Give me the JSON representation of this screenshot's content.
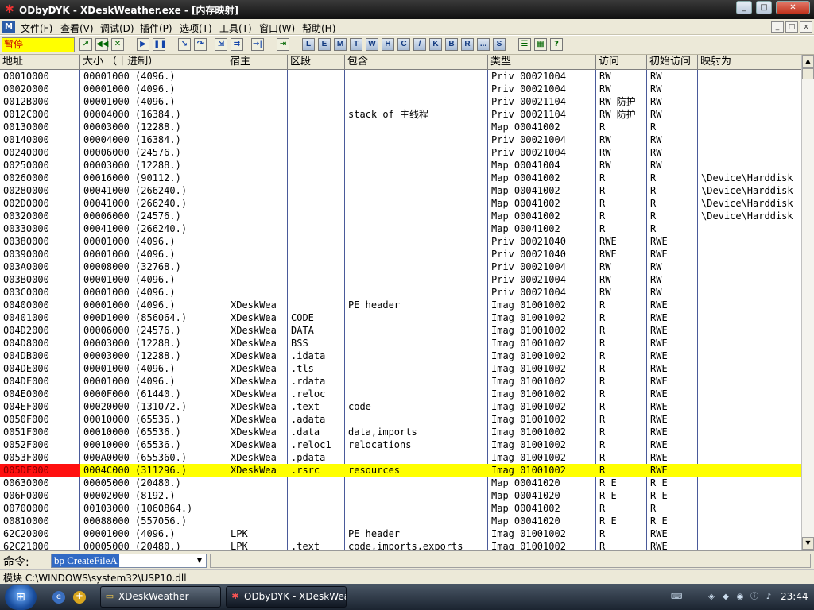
{
  "window": {
    "title": "ODbyDYK - XDeskWeather.exe - [内存映射]",
    "minimize": "_",
    "maximize": "□",
    "close": "✕"
  },
  "menu": {
    "items": [
      "文件(F)",
      "查看(V)",
      "调试(D)",
      "插件(P)",
      "选项(T)",
      "工具(T)",
      "窗口(W)",
      "帮助(H)"
    ],
    "mdi_buttons": [
      "_",
      "□",
      "x"
    ]
  },
  "toolbar": {
    "status": "暂停",
    "letter_buttons": [
      "L",
      "E",
      "M",
      "T",
      "W",
      "H",
      "C",
      "/",
      "K",
      "B",
      "R",
      "...",
      "S"
    ]
  },
  "table": {
    "columns": [
      "地址",
      "大小 （十进制）",
      "宿主",
      "区段",
      "包含",
      "类型",
      "访问",
      "初始访问",
      "映射为"
    ],
    "rows": [
      [
        "00010000",
        "00001000 (4096.)",
        "",
        "",
        "",
        "Priv 00021004",
        "RW",
        "RW",
        ""
      ],
      [
        "00020000",
        "00001000 (4096.)",
        "",
        "",
        "",
        "Priv 00021004",
        "RW",
        "RW",
        ""
      ],
      [
        "0012B000",
        "00001000 (4096.)",
        "",
        "",
        "",
        "Priv 00021104",
        "RW  防护",
        "RW",
        ""
      ],
      [
        "0012C000",
        "00004000 (16384.)",
        "",
        "",
        "stack of 主线程",
        "Priv 00021104",
        "RW  防护",
        "RW",
        ""
      ],
      [
        "00130000",
        "00003000 (12288.)",
        "",
        "",
        "",
        "Map  00041002",
        "R",
        "R",
        ""
      ],
      [
        "00140000",
        "00004000 (16384.)",
        "",
        "",
        "",
        "Priv 00021004",
        "RW",
        "RW",
        ""
      ],
      [
        "00240000",
        "00006000 (24576.)",
        "",
        "",
        "",
        "Priv 00021004",
        "RW",
        "RW",
        ""
      ],
      [
        "00250000",
        "00003000 (12288.)",
        "",
        "",
        "",
        "Map  00041004",
        "RW",
        "RW",
        ""
      ],
      [
        "00260000",
        "00016000 (90112.)",
        "",
        "",
        "",
        "Map  00041002",
        "R",
        "R",
        "\\Device\\Harddisk"
      ],
      [
        "00280000",
        "00041000 (266240.)",
        "",
        "",
        "",
        "Map  00041002",
        "R",
        "R",
        "\\Device\\Harddisk"
      ],
      [
        "002D0000",
        "00041000 (266240.)",
        "",
        "",
        "",
        "Map  00041002",
        "R",
        "R",
        "\\Device\\Harddisk"
      ],
      [
        "00320000",
        "00006000 (24576.)",
        "",
        "",
        "",
        "Map  00041002",
        "R",
        "R",
        "\\Device\\Harddisk"
      ],
      [
        "00330000",
        "00041000 (266240.)",
        "",
        "",
        "",
        "Map  00041002",
        "R",
        "R",
        ""
      ],
      [
        "00380000",
        "00001000 (4096.)",
        "",
        "",
        "",
        "Priv 00021040",
        "RWE",
        "RWE",
        ""
      ],
      [
        "00390000",
        "00001000 (4096.)",
        "",
        "",
        "",
        "Priv 00021040",
        "RWE",
        "RWE",
        ""
      ],
      [
        "003A0000",
        "00008000 (32768.)",
        "",
        "",
        "",
        "Priv 00021004",
        "RW",
        "RW",
        ""
      ],
      [
        "003B0000",
        "00001000 (4096.)",
        "",
        "",
        "",
        "Priv 00021004",
        "RW",
        "RW",
        ""
      ],
      [
        "003C0000",
        "00001000 (4096.)",
        "",
        "",
        "",
        "Priv 00021004",
        "RW",
        "RW",
        ""
      ],
      [
        "00400000",
        "00001000 (4096.)",
        "XDeskWea",
        "",
        "PE header",
        "Imag 01001002",
        "R",
        "RWE",
        ""
      ],
      [
        "00401000",
        "000D1000 (856064.)",
        "XDeskWea",
        "CODE",
        "",
        "Imag 01001002",
        "R",
        "RWE",
        ""
      ],
      [
        "004D2000",
        "00006000 (24576.)",
        "XDeskWea",
        "DATA",
        "",
        "Imag 01001002",
        "R",
        "RWE",
        ""
      ],
      [
        "004D8000",
        "00003000 (12288.)",
        "XDeskWea",
        "BSS",
        "",
        "Imag 01001002",
        "R",
        "RWE",
        ""
      ],
      [
        "004DB000",
        "00003000 (12288.)",
        "XDeskWea",
        ".idata",
        "",
        "Imag 01001002",
        "R",
        "RWE",
        ""
      ],
      [
        "004DE000",
        "00001000 (4096.)",
        "XDeskWea",
        ".tls",
        "",
        "Imag 01001002",
        "R",
        "RWE",
        ""
      ],
      [
        "004DF000",
        "00001000 (4096.)",
        "XDeskWea",
        ".rdata",
        "",
        "Imag 01001002",
        "R",
        "RWE",
        ""
      ],
      [
        "004E0000",
        "0000F000 (61440.)",
        "XDeskWea",
        ".reloc",
        "",
        "Imag 01001002",
        "R",
        "RWE",
        ""
      ],
      [
        "004EF000",
        "00020000 (131072.)",
        "XDeskWea",
        ".text",
        "code",
        "Imag 01001002",
        "R",
        "RWE",
        ""
      ],
      [
        "0050F000",
        "00010000 (65536.)",
        "XDeskWea",
        ".adata",
        "",
        "Imag 01001002",
        "R",
        "RWE",
        ""
      ],
      [
        "0051F000",
        "00010000 (65536.)",
        "XDeskWea",
        ".data",
        "data,imports",
        "Imag 01001002",
        "R",
        "RWE",
        ""
      ],
      [
        "0052F000",
        "00010000 (65536.)",
        "XDeskWea",
        ".reloc1",
        "relocations",
        "Imag 01001002",
        "R",
        "RWE",
        ""
      ],
      [
        "0053F000",
        "000A0000 (655360.)",
        "XDeskWea",
        ".pdata",
        "",
        "Imag 01001002",
        "R",
        "RWE",
        ""
      ],
      [
        "005DF000",
        "0004C000 (311296.)",
        "XDeskWea",
        ".rsrc",
        "resources",
        "Imag 01001002",
        "R",
        "RWE",
        ""
      ],
      [
        "00630000",
        "00005000 (20480.)",
        "",
        "",
        "",
        "Map  00041020",
        "R E",
        "R E",
        ""
      ],
      [
        "006F0000",
        "00002000 (8192.)",
        "",
        "",
        "",
        "Map  00041020",
        "R E",
        "R E",
        ""
      ],
      [
        "00700000",
        "00103000 (1060864.)",
        "",
        "",
        "",
        "Map  00041002",
        "R",
        "R",
        ""
      ],
      [
        "00810000",
        "00088000 (557056.)",
        "",
        "",
        "",
        "Map  00041020",
        "R E",
        "R E",
        ""
      ],
      [
        "62C20000",
        "00001000 (4096.)",
        "LPK",
        "",
        "PE header",
        "Imag 01001002",
        "R",
        "RWE",
        ""
      ],
      [
        "62C21000",
        "00005000 (20480.)",
        "LPK",
        ".text",
        "code,imports,exports",
        "Imag 01001002",
        "R",
        "RWE",
        ""
      ]
    ],
    "selected_row_index": 31
  },
  "command": {
    "label": "命令:",
    "value": "bp CreateFileA"
  },
  "status": {
    "text": "模块 C:\\WINDOWS\\system32\\USP10.dll"
  },
  "taskbar": {
    "tasks": [
      "XDeskWeather",
      "ODbyDYK - XDeskWea..."
    ],
    "clock": "23:44"
  },
  "colors": {
    "selected_row": "#ffff00",
    "selected_address": "#ff1010",
    "status_paused_bg": "#ffff00",
    "status_paused_text": "#cc0000"
  }
}
